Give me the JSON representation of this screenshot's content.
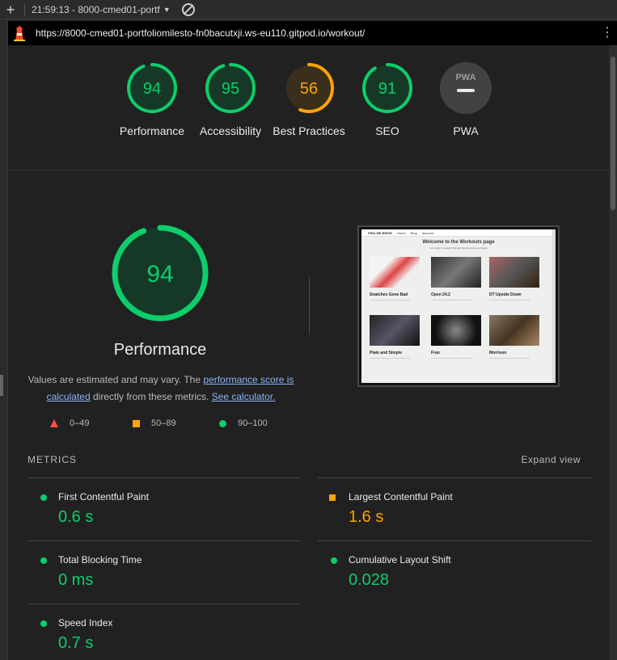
{
  "browser": {
    "tab_title": "21:59:13 - 8000-cmed01-portf",
    "url": "https://8000-cmed01-portfoliomilesto-fn0bacutxji.ws-eu110.gitpod.io/workout/"
  },
  "gauges": [
    {
      "label": "Performance",
      "score": "94",
      "score_value": 94,
      "rating": "pass"
    },
    {
      "label": "Accessibility",
      "score": "95",
      "score_value": 95,
      "rating": "pass"
    },
    {
      "label": "Best Practices",
      "score": "56",
      "score_value": 56,
      "rating": "average"
    },
    {
      "label": "SEO",
      "score": "91",
      "score_value": 91,
      "rating": "pass"
    },
    {
      "label": "PWA",
      "badge": "PWA",
      "rating": "na"
    }
  ],
  "performance": {
    "score": "94",
    "score_value": 94,
    "title": "Performance",
    "note_pre": "Values are estimated and may vary. The ",
    "note_link1": "performance score is calculated",
    "note_mid": " directly from these metrics. ",
    "note_link2": "See calculator."
  },
  "legend": {
    "fail": "0–49",
    "average": "50–89",
    "pass": "90–100"
  },
  "screenshot": {
    "brand": "FIND ME BRIDE",
    "nav": [
      "Home",
      "Blog",
      "Account"
    ],
    "title": "Welcome to the Workouts page",
    "subtitle": "Get ready to sweat! Find and download free workouts",
    "cards": [
      {
        "name": "Snatches Gone Bad"
      },
      {
        "name": "Open 24.2"
      },
      {
        "name": "DT Upside Down"
      },
      {
        "name": "Plain and Simple"
      },
      {
        "name": "Fran"
      },
      {
        "name": "Morrison"
      }
    ]
  },
  "metrics": {
    "heading": "METRICS",
    "expand": "Expand view",
    "items": [
      {
        "name": "First Contentful Paint",
        "value": "0.6 s",
        "rating": "pass"
      },
      {
        "name": "Largest Contentful Paint",
        "value": "1.6 s",
        "rating": "average"
      },
      {
        "name": "Total Blocking Time",
        "value": "0 ms",
        "rating": "pass"
      },
      {
        "name": "Cumulative Layout Shift",
        "value": "0.028",
        "rating": "pass"
      },
      {
        "name": "Speed Index",
        "value": "0.7 s",
        "rating": "pass"
      }
    ]
  },
  "colors": {
    "pass": "#0cce6b",
    "average": "#ffa400",
    "fail": "#ff4e42"
  }
}
